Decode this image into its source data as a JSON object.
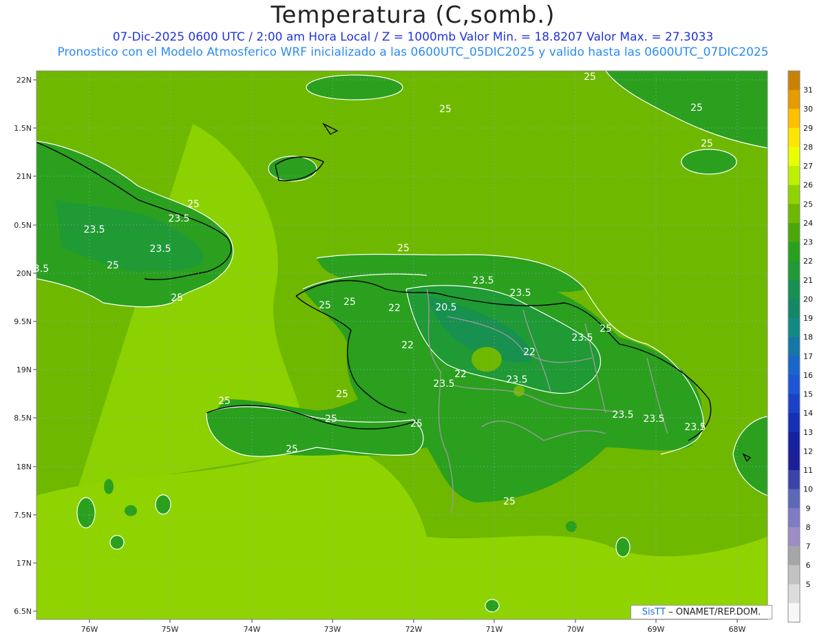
{
  "header": {
    "title": "Temperatura (C,somb.)",
    "subtitle_line1": "07-Dic-2025  0600 UTC / 2:00 am Hora Local / Z = 1000mb   Valor Min. = 18.8207  Valor Max. = 27.3033",
    "subtitle_line2": "Pronostico con el Modelo Atmosferico WRF inicializado a las 0600UTC_05DIC2025 y valido hasta las  0600UTC_07DIC2025"
  },
  "axes": {
    "x_ticks": [
      "76W",
      "75W",
      "74W",
      "73W",
      "72W",
      "71W",
      "70W",
      "69W",
      "68W"
    ],
    "y_ticks": [
      "22N",
      "1.5N",
      "21N",
      "0.5N",
      "20N",
      "9.5N",
      "19N",
      "8.5N",
      "18N",
      "7.5N",
      "17N",
      "6.5N"
    ]
  },
  "colorbar": {
    "levels": [
      31,
      30,
      29,
      28,
      27,
      26,
      25,
      24,
      23,
      22,
      21,
      20,
      19,
      18,
      17,
      16,
      15,
      14,
      13,
      12,
      11,
      10,
      9,
      8,
      7,
      6,
      5
    ],
    "colors": [
      "#c88200",
      "#e69b00",
      "#ffc000",
      "#ffe600",
      "#e9ff00",
      "#bff000",
      "#8fd400",
      "#6fb800",
      "#4ca80a",
      "#2aa01e",
      "#1f9a35",
      "#179050",
      "#138866",
      "#118a86",
      "#1576a8",
      "#1a66c8",
      "#1d55d4",
      "#1a42c8",
      "#1530b4",
      "#1421a0",
      "#1b1f98",
      "#3a44a8",
      "#5c68b8",
      "#7e7cc4",
      "#9e8cc6",
      "#a6a6a6",
      "#c2c2c2",
      "#dcdcdc",
      "#f7f7f7"
    ]
  },
  "contour_labels": [
    "25",
    "25",
    "25",
    "25",
    "25",
    "23.5",
    "23.5",
    "23.5",
    "25",
    "25",
    "3.5",
    "25",
    "25",
    "23.5",
    "25",
    "23.5",
    "22",
    "20.5",
    "22",
    "22",
    "25",
    "23.5",
    "22",
    "23.5",
    "23.5",
    "23.5",
    "25",
    "25",
    "25",
    "25",
    "23.5",
    "23.5",
    "25",
    "25"
  ],
  "credit": {
    "brand": "SisTT",
    "text": "– ONAMET/REP.DOM."
  }
}
